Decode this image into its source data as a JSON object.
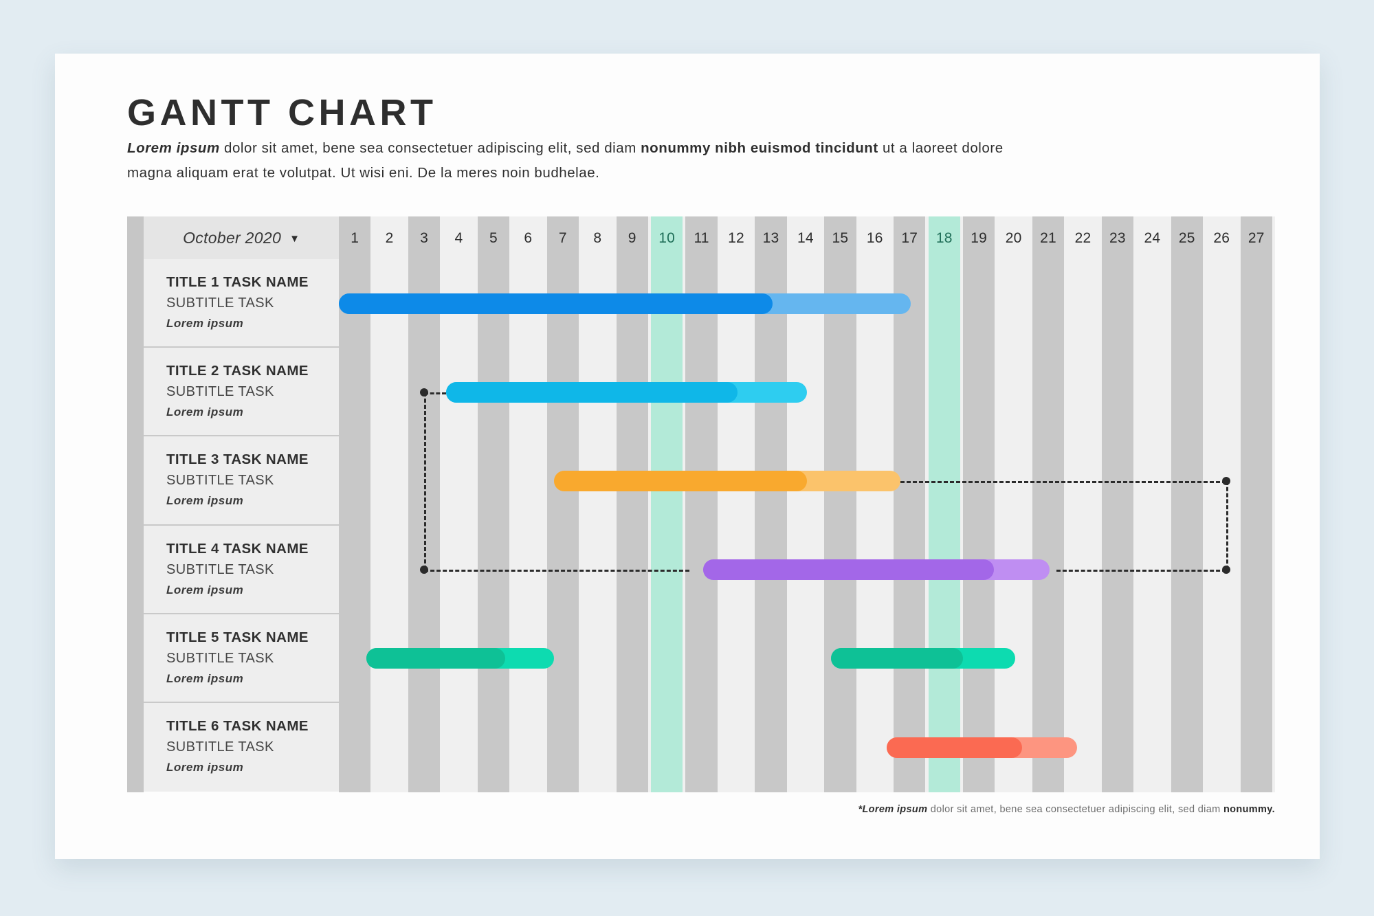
{
  "page": {
    "background_color": "#e2ecf2",
    "card_color": "#fdfdfd"
  },
  "header": {
    "title": "GANTT CHART",
    "subtitle_lead": "Lorem ipsum",
    "subtitle_mid": " dolor sit amet, bene sea consectetuer adipiscing elit, sed diam ",
    "subtitle_bold1": "nonummy nibh euismod tincidunt",
    "subtitle_tail": " ut a laoreet dolore magna aliquam erat te volutpat. Ut wisi eni. De la meres noin budhelae."
  },
  "timeline": {
    "month_label": "October 2020",
    "caret_icon": "▼",
    "days": [
      "1",
      "2",
      "3",
      "4",
      "5",
      "6",
      "7",
      "8",
      "9",
      "10",
      "11",
      "12",
      "13",
      "14",
      "15",
      "16",
      "17",
      "18",
      "19",
      "20",
      "21",
      "22",
      "23",
      "24",
      "25",
      "26",
      "27"
    ],
    "highlighted_days": [
      "10",
      "18"
    ],
    "highlight_color": "#b3ead8",
    "shade_color": "#c8c8c8",
    "base_color": "#f0f0f0"
  },
  "tasks": [
    {
      "title": "TITLE 1  TASK NAME",
      "subtitle": "SUBTITLE TASK",
      "note": "Lorem ipsum"
    },
    {
      "title": "TITLE 2  TASK NAME",
      "subtitle": "SUBTITLE TASK",
      "note": "Lorem ipsum"
    },
    {
      "title": "TITLE 3  TASK NAME",
      "subtitle": "SUBTITLE TASK",
      "note": "Lorem ipsum"
    },
    {
      "title": "TITLE 4  TASK NAME",
      "subtitle": "SUBTITLE TASK",
      "note": "Lorem ipsum"
    },
    {
      "title": "TITLE 5  TASK NAME",
      "subtitle": "SUBTITLE TASK",
      "note": "Lorem ipsum"
    },
    {
      "title": "TITLE 6  TASK NAME",
      "subtitle": "SUBTITLE TASK",
      "note": "Lorem ipsum"
    }
  ],
  "footnote": {
    "star": "*",
    "lead": "Lorem ipsum",
    "mid": " dolor sit amet, bene sea consectetuer adipiscing elit, sed diam ",
    "bold": "nonummy."
  },
  "chart_data": {
    "type": "bar",
    "title": "GANTT CHART",
    "xlabel": "October 2020",
    "ylabel": "",
    "x": [
      1,
      2,
      3,
      4,
      5,
      6,
      7,
      8,
      9,
      10,
      11,
      12,
      13,
      14,
      15,
      16,
      17,
      18,
      19,
      20,
      21,
      22,
      23,
      24,
      25,
      26,
      27
    ],
    "xlim": [
      1,
      28
    ],
    "grid": true,
    "legend": "none",
    "categories": [
      "TITLE 1  TASK NAME",
      "TITLE 2  TASK NAME",
      "TITLE 3  TASK NAME",
      "TITLE 4  TASK NAME",
      "TITLE 5  TASK NAME",
      "TITLE 6  TASK NAME"
    ],
    "series": [
      {
        "name": "TITLE 1  TASK NAME",
        "row": 1,
        "bars": [
          {
            "start_day": 1,
            "end_day": 17.5,
            "progress_end_day": 13.5,
            "color": "#0d8ae8",
            "remainder_color": "#65b6ef"
          }
        ]
      },
      {
        "name": "TITLE 2  TASK NAME",
        "row": 2,
        "bars": [
          {
            "start_day": 4.1,
            "end_day": 14.5,
            "progress_end_day": 12.5,
            "color": "#0fb7e8",
            "remainder_color": "#2ecdf0"
          }
        ]
      },
      {
        "name": "TITLE 3  TASK NAME",
        "row": 3,
        "bars": [
          {
            "start_day": 7.2,
            "end_day": 17.2,
            "progress_end_day": 14.5,
            "color": "#f9a92e",
            "remainder_color": "#fbc36b"
          }
        ]
      },
      {
        "name": "TITLE 4  TASK NAME",
        "row": 4,
        "bars": [
          {
            "start_day": 11.5,
            "end_day": 21.5,
            "progress_end_day": 19.9,
            "color": "#a367e8",
            "remainder_color": "#bf8ef2"
          }
        ]
      },
      {
        "name": "TITLE 5  TASK NAME",
        "row": 5,
        "bars": [
          {
            "start_day": 1.8,
            "end_day": 7.2,
            "progress_end_day": 5.8,
            "color": "#0ec196",
            "remainder_color": "#0ddbb0"
          },
          {
            "start_day": 15.2,
            "end_day": 20.5,
            "progress_end_day": 19.0,
            "color": "#0ec196",
            "remainder_color": "#0ddbb0"
          }
        ]
      },
      {
        "name": "TITLE 6  TASK NAME",
        "row": 6,
        "bars": [
          {
            "start_day": 16.8,
            "end_day": 22.3,
            "progress_end_day": 20.7,
            "color": "#fb6a52",
            "remainder_color": "#fd9580"
          }
        ]
      }
    ],
    "dependencies": [
      {
        "from_row": 2,
        "to_row": 4,
        "shape": "left-elbow",
        "style": "dashed",
        "color": "#2b2b2b"
      },
      {
        "from_row": 3,
        "to_row": 4,
        "shape": "right-elbow",
        "style": "dashed",
        "color": "#2b2b2b"
      }
    ]
  }
}
